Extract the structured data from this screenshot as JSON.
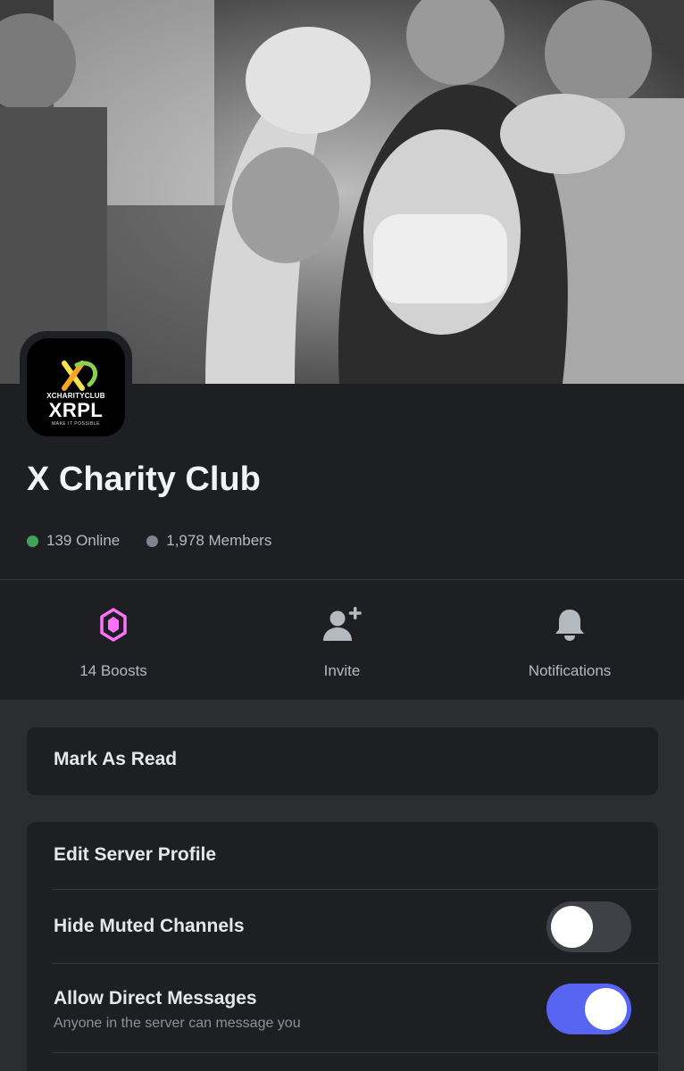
{
  "server": {
    "name": "X Charity Club",
    "logo": {
      "small_text": "XCHARITYCLUB",
      "big_text": "XRPL",
      "tagline": "MAKE IT POSSIBLE"
    }
  },
  "stats": {
    "online": "139 Online",
    "members": "1,978 Members"
  },
  "actions": {
    "boosts_label": "14 Boosts",
    "invite_label": "Invite",
    "notifications_label": "Notifications"
  },
  "menu": {
    "mark_as_read": "Mark As Read",
    "edit_server_profile": "Edit Server Profile",
    "hide_muted_channels": {
      "label": "Hide Muted Channels",
      "enabled": false
    },
    "allow_direct_messages": {
      "label": "Allow Direct Messages",
      "description": "Anyone in the server can message you",
      "enabled": true
    }
  },
  "colors": {
    "accent": "#5865f2",
    "boost": "#ff73fa",
    "online": "#43a25a",
    "members": "#80848e"
  },
  "icons": {
    "boosts": "boost-gem-icon",
    "invite": "add-user-icon",
    "notifications": "bell-icon"
  }
}
